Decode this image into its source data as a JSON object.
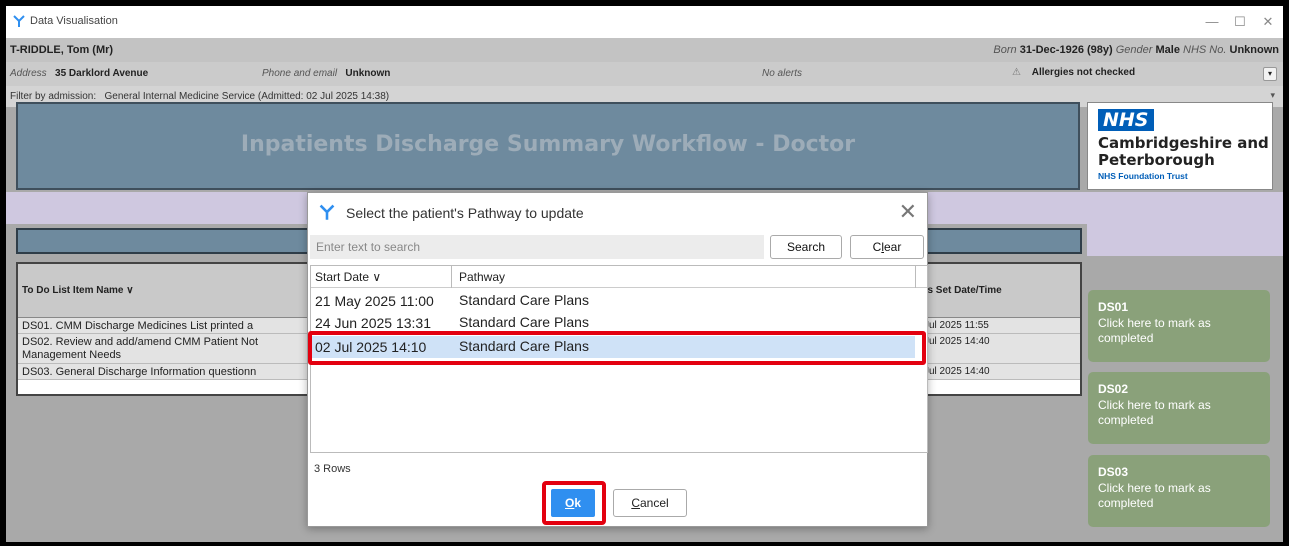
{
  "window": {
    "title": "Data Visualisation",
    "controls": {
      "minimize": "—",
      "maximize": "☐",
      "close": "✕"
    }
  },
  "patient": {
    "name": "T-RIDDLE, Tom (Mr)",
    "born_label": "Born",
    "born_value": "31-Dec-1926 (98y)",
    "gender_label": "Gender",
    "gender_value": "Male",
    "nhs_label": "NHS No.",
    "nhs_value": "Unknown",
    "address_label": "Address",
    "address_value": "35 Darklord Avenue",
    "phone_label": "Phone and email",
    "phone_value": "Unknown",
    "alerts": "No alerts",
    "allergies": "Allergies not checked",
    "expand_icon": "▾"
  },
  "filter": {
    "label": "Filter by admission:",
    "value": "General Internal Medicine Service (Admitted: 02 Jul 2025 14:38)",
    "caret": "▾"
  },
  "banner": {
    "title": "Inpatients Discharge Summary Workflow  -  Doctor"
  },
  "nhs": {
    "logo": "NHS",
    "org_line1": "Cambridgeshire and",
    "org_line2": "Peterborough",
    "org_line3": "NHS Foundation Trust"
  },
  "todo_table": {
    "col_name": "To Do List Item Name ∨",
    "col_status": "tus Set Date/Time",
    "rows": [
      {
        "name": "DS01. CMM Discharge Medicines List printed a",
        "status_time": "Jul 2025 11:55"
      },
      {
        "name": "DS02. Review and add/amend CMM Patient Not Management Needs",
        "status_time": "Jul 2025 14:40"
      },
      {
        "name": "DS03. General Discharge Information questionn",
        "status_time": "Jul 2025 14:40"
      }
    ]
  },
  "cards": [
    {
      "id": "DS01",
      "text": "Click here to mark as completed"
    },
    {
      "id": "DS02",
      "text": "Click here to mark as completed"
    },
    {
      "id": "DS03",
      "text": "Click here to mark as completed"
    }
  ],
  "dialog": {
    "title": "Select the patient's Pathway to update",
    "close": "✕",
    "search_placeholder": "Enter text to search",
    "search_value": "",
    "search_button": "Search",
    "clear_button": "Clear",
    "col_start": "Start Date ∨",
    "col_pathway": "Pathway",
    "rows": [
      {
        "start": "21 May 2025 11:00",
        "pathway": "Standard Care Plans"
      },
      {
        "start": "24 Jun 2025 13:31",
        "pathway": "Standard Care Plans"
      },
      {
        "start": "02 Jul 2025 14:10",
        "pathway": "Standard Care Plans"
      }
    ],
    "rows_count": "3 Rows",
    "ok_button": "Ok",
    "cancel_button": "Cancel"
  },
  "colors": {
    "banner": "#6e8a9e",
    "card": "#8aa17a",
    "selected_row": "#cfe2f7",
    "ok": "#2f8ff0",
    "highlight": "#e3000f"
  }
}
